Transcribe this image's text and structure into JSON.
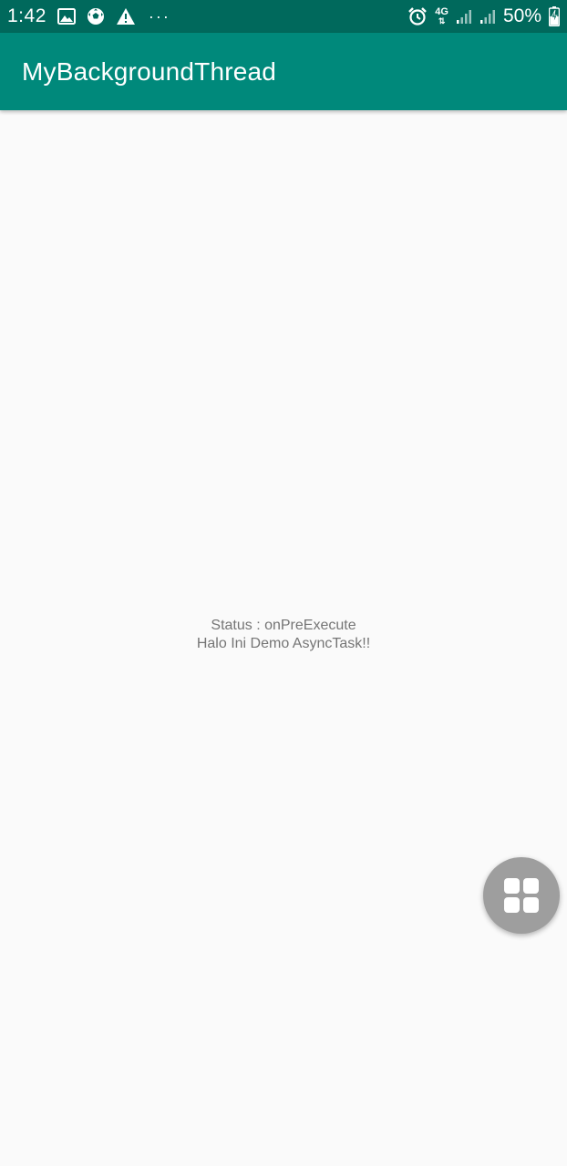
{
  "status_bar": {
    "time": "1:42",
    "left_icons": [
      "image-icon",
      "soccer-ball-icon",
      "warning-icon"
    ],
    "more_dots": "···",
    "alarm_icon": "alarm-icon",
    "network_type": "4G",
    "battery_percent": "50%",
    "battery_icon": "battery-charging-icon"
  },
  "app_bar": {
    "title": "MyBackgroundThread"
  },
  "main": {
    "status_text": "Status : onPreExecute",
    "message_text": "Halo Ini Demo AsyncTask!!"
  },
  "fab": {
    "icon": "grid-apps-icon"
  },
  "colors": {
    "status_bar": "#00695c",
    "app_bar": "#00897b",
    "background": "#fafafa",
    "text_secondary": "#757575",
    "fab": "#9e9e9e"
  }
}
